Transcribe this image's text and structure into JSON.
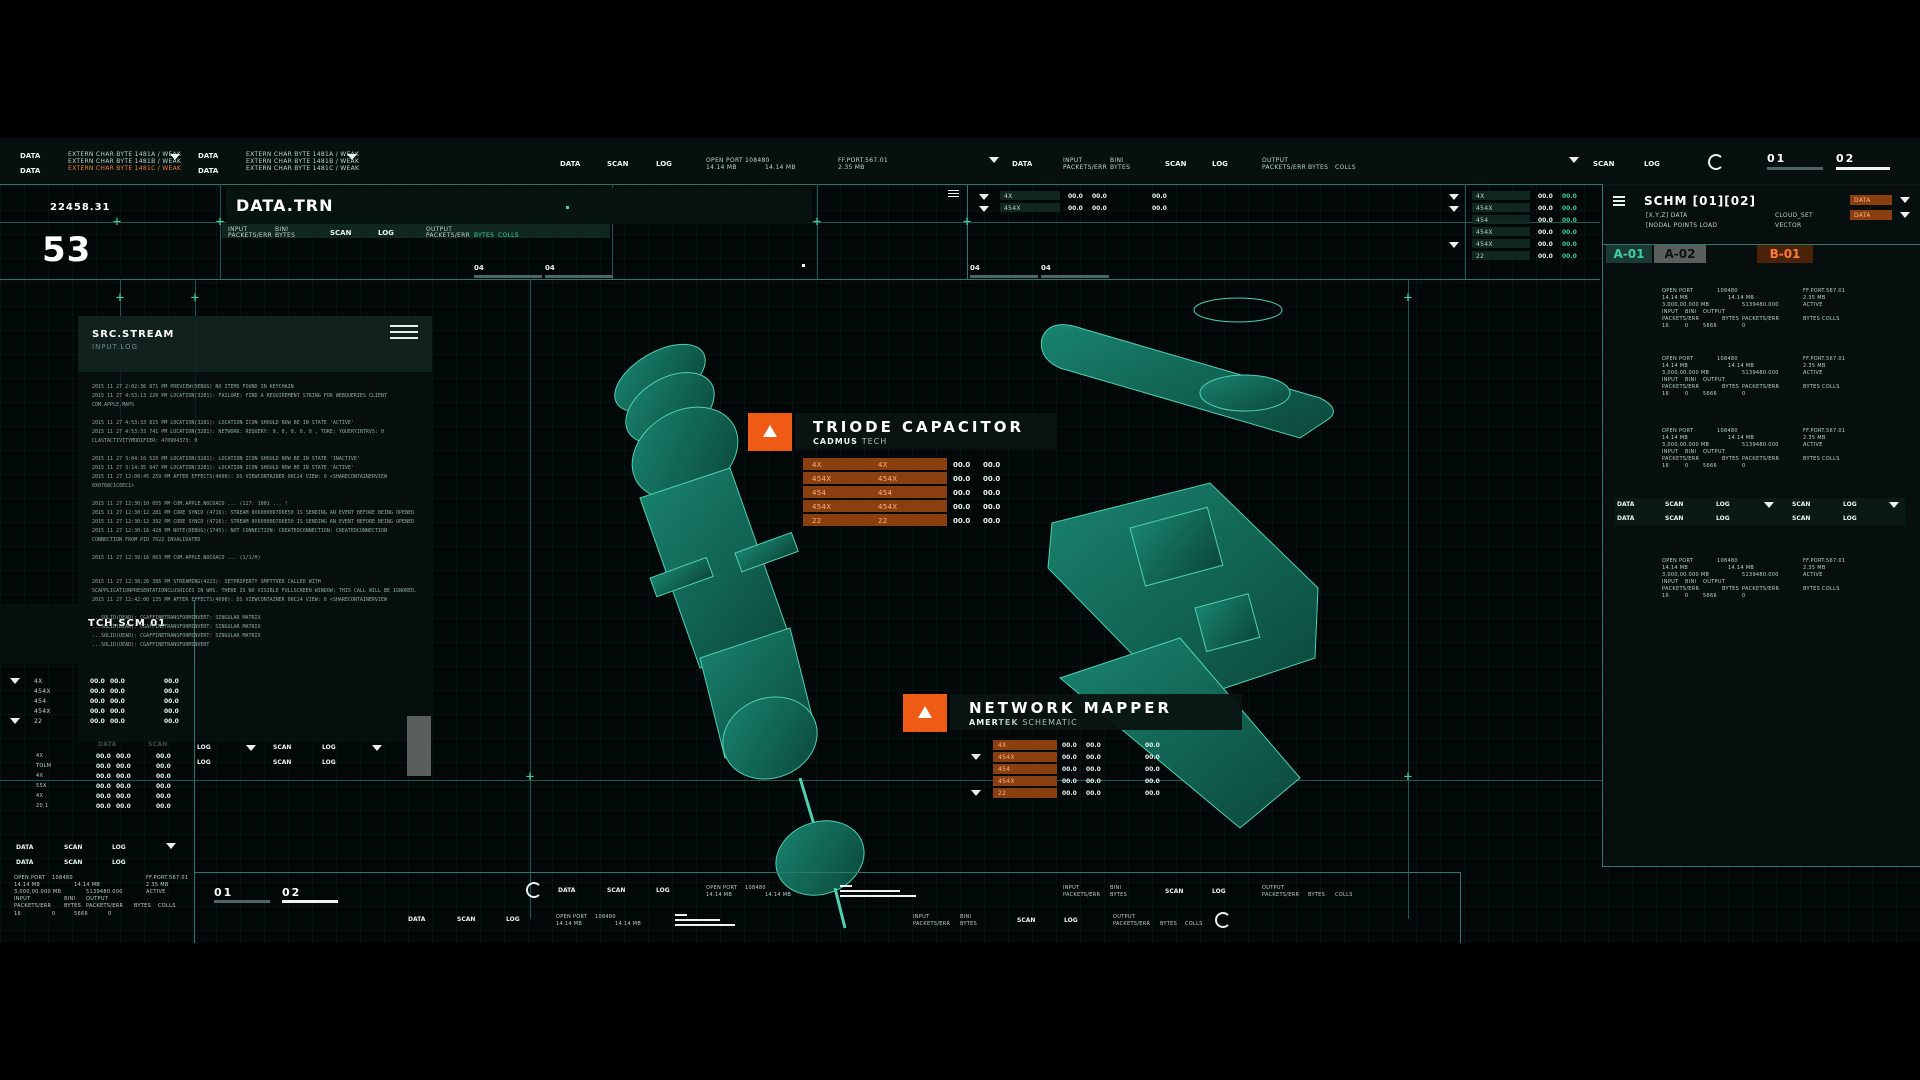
{
  "top": {
    "left_group_1": {
      "label_top": "DATA",
      "label_bottom": "DATA",
      "lines": [
        "EXTERN CHAR BYTE 1481A / WEAK",
        "EXTERN CHAR BYTE 1481B / WEAK",
        "EXTERN CHAR BYTE 1481C / WEAK"
      ]
    },
    "left_group_2": {
      "label_top": "DATA",
      "label_bottom": "DATA",
      "lines": [
        "EXTERN CHAR BYTE 1481A / WEAK",
        "EXTERN CHAR BYTE 1481B / WEAK",
        "EXTERN CHAR BYTE 1481C / WEAK"
      ]
    },
    "mid_labels": [
      "DATA",
      "SCAN",
      "LOG"
    ],
    "port_block": {
      "l1": "OPEN PORT",
      "v1": "108480",
      "l2": "14.14 MB",
      "v2": "14.14 MB"
    },
    "port2": {
      "l1": "FF.PORT.567.01",
      "l2": "2.35 MB"
    },
    "mid2_labels": [
      "DATA",
      "INPUT",
      "BINI",
      "SCAN",
      "LOG",
      "OUTPUT"
    ],
    "mid2_sub": [
      "PACKETS/ERR",
      "BYTES",
      "PACKETS/ERR",
      "BYTES",
      "COLLS"
    ],
    "right_labels": [
      "SCAN",
      "LOG"
    ],
    "tab_01": "01",
    "tab_02": "02"
  },
  "header": {
    "number_small": "22458.31",
    "number_big": "53",
    "title": "DATA.TRN",
    "sub": [
      "INPUT",
      "BINI",
      "SCAN",
      "LOG",
      "OUTPUT"
    ],
    "sub2": [
      "PACKETS/ERR",
      "BYTES",
      "PACKETS/ERR",
      "BYTES",
      "COLLS"
    ],
    "tab_a": "04",
    "tab_b": "04",
    "tab_c": "04",
    "tab_d": "04",
    "mini_rows": [
      {
        "k": "4X",
        "a": "00.0",
        "b": "00.0",
        "c": "00.0"
      },
      {
        "k": "454X",
        "a": "00.0",
        "b": "00.0",
        "c": "00.0"
      }
    ],
    "right_rows": [
      {
        "k": "4X",
        "a": "00.0",
        "b": "00.0"
      },
      {
        "k": "454X",
        "a": "00.0",
        "b": "00.0"
      },
      {
        "k": "454",
        "a": "00.0",
        "b": "00.0"
      },
      {
        "k": "454X",
        "a": "00.0",
        "b": "00.0"
      },
      {
        "k": "454X",
        "a": "00.0",
        "b": "00.0"
      },
      {
        "k": "22",
        "a": "00.0",
        "b": "00.0"
      }
    ]
  },
  "schm": {
    "title": "SCHM [01][02]",
    "l1": "[X,Y,Z] DATA",
    "l2": "[NODAL POINTS LOAD",
    "r1": "CLOUD_SET",
    "r2": "VECTOR",
    "badge1": "DATA",
    "badge2": "DATA",
    "tab1": "A-01",
    "tab2": "A-02",
    "tab3": "B-01",
    "ctrl_row1": [
      "DATA",
      "SCAN",
      "LOG",
      "SCAN",
      "LOG"
    ],
    "ctrl_row2": [
      "DATA",
      "SCAN",
      "LOG",
      "SCAN",
      "LOG"
    ]
  },
  "src": {
    "title": "SRC.STREAM",
    "sub": "INPUT.LOG",
    "log": [
      "2015 11 27 2:02:36 871 PM PREVIEW(DEBUG) NO ITEMS FOUND IN KEYCHAIN",
      "2015 11 27 4:53:13 220 PM LOCATION(3281): FAILURE: FIND A REQUIREMENT STRING FOR WEBQUERIES CLIENT",
      "COM.APPLE.MAPS",
      "",
      "2015 11 27 4:53:33 815 PM LOCATION(3281): LOCATION ICON SHOULD NOW BE IN STATE 'ACTIVE'",
      "2015 11 27 4:53:33 741 PM LOCATION(3281): NETWORK: REQUERY: 0, 0, 0, 0, 0 , TORE: YQUERYINTRVS: 0",
      "CLASTACTIVITYMODIFIER: 470904373: 0",
      "",
      "2015 11 27 3:04:16 520 PM LOCATION(3281): LOCATION ICON SHOULD NOW BE IN STATE 'INACTIVE'",
      "2015 11 27 3:14:35 947 PM LOCATION(3281): LOCATION ICON SHOULD NOW BE IN STATE 'ACTIVE'",
      "2015 11 27 12:00:45 259 PM AFTER EFFECTS(4000): DS VIEWCONTAINER 00C24 VIEW: 0 <SHARECONTAINERVIEW",
      "0X0768C1C6EC1>",
      "",
      "2015 11 27 12:30:10 055 PM COM.APPLE.NOCOACD ... (117: 1001 ... !",
      "2015 11 27 12:30:12 281 PM CORE SYNCD (4716): STREAM 0X60000D7D6E50 IS SENDING AN EVENT BEFORE BEING OPENED",
      "2015 11 27 12:30:12 392 PM CORE SYNCD (4716): STREAM 0X60000D7D6E50 IS SENDING AN EVENT BEFORE BEING OPENED",
      "2015 11 27 12:30:16 428 PM NOTE(DEBUG)(1745): NOT CONNECTION: CREATEDCONNECTION: CREATEDCONNECTION",
      "CONNECTION FROM PID 7022 INVALIDATED",
      "",
      "2015 11 27 12:39:16 063 PM COM.APPLE.NOCOACD ... (1/1/H)"
    ],
    "log2": [
      "2015 11 27 12:38:26 386 PM STREAMING(4223): SETPROPERTY SMPTTVER CALLED WITH",
      "SCAPPLICATIONPRESENTATIONCLUSRICES IN WHS. THERE IS NO VISIBLE FULLSCREEN WINDOW; THIS CALL WILL BE IGNORED.",
      "2015 11 27 12:42:00 135 PM AFTER EFFECTS(4000): DS VIEWCONTAINER 00C24 VIEW: 0 <SHARECONTAINERVIEW",
      "",
      "...SOLID(DEAD): CGAFFINETRANSFORMINVERT: SINGULAR MATRIX",
      "...SOLID(DEAD): CGAFFINETRANSFORMINVERT: SINGULAR MATRIX",
      "...SOLID(DEAD): CGAFFINETRANSFORMINVERT: SINGULAR MATRIX",
      "...SOLID(DEAD): CGAFFINETRANSFORMINVERT"
    ]
  },
  "tch": {
    "title": "TCH.SCM 01",
    "rows": [
      {
        "k": "4X",
        "a": "00.0",
        "b": "00.0",
        "c": "00.0"
      },
      {
        "k": "454X",
        "a": "00.0",
        "b": "00.0",
        "c": "00.0"
      },
      {
        "k": "454",
        "a": "00.0",
        "b": "00.0",
        "c": "00.0"
      },
      {
        "k": "454X",
        "a": "00.0",
        "b": "00.0",
        "c": "00.0"
      },
      {
        "k": "22",
        "a": "00.0",
        "b": "00.0",
        "c": "00.0"
      }
    ],
    "sub_head": [
      "DATA",
      "SCAN"
    ],
    "sub_rows": [
      {
        "k": "4X",
        "a": "00.0",
        "b": "00.0",
        "c": "00.0"
      },
      {
        "k": "TOLM",
        "a": "00.0",
        "b": "00.0",
        "c": "00.0"
      },
      {
        "k": "4X",
        "a": "00.0",
        "b": "00.0",
        "c": "00.0"
      },
      {
        "k": "55X",
        "a": "00.0",
        "b": "00.0",
        "c": "00.0"
      },
      {
        "k": "4X",
        "a": "00.0",
        "b": "00.0",
        "c": "00.0"
      },
      {
        "k": "20.1",
        "a": "00.0",
        "b": "00.0",
        "c": "00.0"
      }
    ],
    "ctrl_1": [
      "LOG",
      "SCAN",
      "LOG"
    ],
    "ctrl_2": [
      "LOG",
      "SCAN",
      "LOG"
    ]
  },
  "bottom_left": {
    "row1": [
      "DATA",
      "SCAN",
      "LOG"
    ],
    "row2": [
      "DATA",
      "SCAN",
      "LOG"
    ],
    "port": [
      "OPEN PORT",
      "108480",
      "FF.PORT.567.01"
    ],
    "line2": [
      "14.14 MB",
      "14.14 MB",
      "2.35 MB"
    ],
    "line3": [
      "3,000,00.000 MB",
      "5139480.000",
      "ACTIVE"
    ],
    "line4": [
      "INPUT",
      "BINI",
      "OUTPUT"
    ],
    "line5": [
      "PACKETS/ERR",
      "BYTES",
      "PACKETS/ERR",
      "BYTES",
      "COLLS"
    ],
    "line6": [
      "16",
      "0",
      "5666",
      "0"
    ]
  },
  "triode": {
    "title": "TRIODE CAPACITOR",
    "brand": "CADMUS",
    "brand_suffix": "TECH",
    "rows": [
      {
        "a": "4X",
        "b": "4X",
        "c": "00.0",
        "d": "00.0"
      },
      {
        "a": "454X",
        "b": "454X",
        "c": "00.0",
        "d": "00.0"
      },
      {
        "a": "454",
        "b": "454",
        "c": "00.0",
        "d": "00.0"
      },
      {
        "a": "454X",
        "b": "454X",
        "c": "00.0",
        "d": "00.0"
      },
      {
        "a": "22",
        "b": "22",
        "c": "00.0",
        "d": "00.0"
      }
    ]
  },
  "netmap": {
    "title": "NETWORK MAPPER",
    "brand": "AMER",
    "brand_mid": "TEK",
    "brand_suffix": "SCHEMATIC",
    "rows": [
      {
        "a": "4X",
        "b": "00.0",
        "c": "00.0",
        "d": "00.0"
      },
      {
        "a": "454X",
        "b": "00.0",
        "c": "00.0",
        "d": "00.0"
      },
      {
        "a": "454",
        "b": "00.0",
        "c": "00.0",
        "d": "00.0"
      },
      {
        "a": "454X",
        "b": "00.0",
        "c": "00.0",
        "d": "00.0"
      },
      {
        "a": "22",
        "b": "00.0",
        "c": "00.0",
        "d": "00.0"
      }
    ]
  },
  "bottom": {
    "tab_01": "01",
    "tab_02": "02",
    "labels": [
      "DATA",
      "SCAN",
      "LOG"
    ],
    "port": [
      "OPEN PORT",
      "108480",
      "14.14 MB",
      "14.14 MB"
    ],
    "labels2": [
      "DATA",
      "SCAN",
      "LOG"
    ],
    "port2": [
      "OPEN PORT",
      "108480",
      "14.14 MB",
      "14.14 MB"
    ],
    "mid": [
      "INPUT",
      "BINI",
      "SCAN",
      "LOG",
      "OUTPUT"
    ],
    "mid_sub": [
      "PACKETS/ERR",
      "BYTES",
      "PACKETS/ERR",
      "BYTES",
      "COLLS"
    ],
    "mid2": [
      "INPUT",
      "BINI",
      "SCAN",
      "LOG",
      "OUTPUT"
    ],
    "mid2_sub": [
      "PACKETS/ERR",
      "BYTES",
      "PACKETS/ERR",
      "BYTES",
      "COLLS"
    ]
  },
  "right_data": {
    "blocks": [
      {
        "l1": "OPEN PORT",
        "v1": "108480",
        "r1": "FF.PORT.567.01",
        "l2": "14.14 MB",
        "v2": "14.14 MB",
        "r2": "2.35 MB",
        "l3": "3,000,00.000 MB",
        "v3": "5139480.000",
        "r3": "ACTIVE",
        "l4": "INPUT",
        "v4": "BINI",
        "r4": "OUTPUT",
        "l5": "PACKETS/ERR",
        "v5": "BYTES",
        "r5": "PACKETS/ERR",
        "s5": "BYTES",
        "t5": "COLLS",
        "l6": "16",
        "v6": "0",
        "r6": "5666",
        "s6": "0"
      }
    ]
  },
  "colors": {
    "accent": "#ef5a14",
    "teal": "#3fd19e",
    "line": "#1f5a4c",
    "bg": "#020807"
  }
}
